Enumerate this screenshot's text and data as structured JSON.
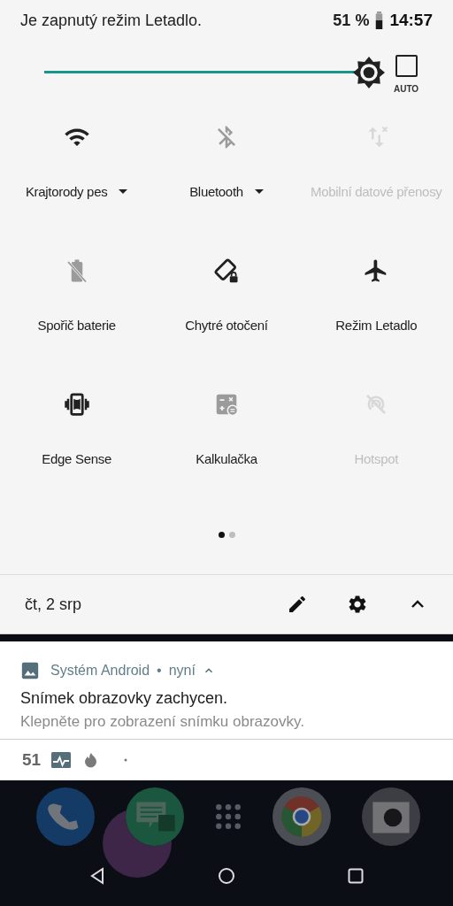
{
  "status_bar": {
    "message": "Je zapnutý režim Letadlo.",
    "battery": "51 %",
    "time": "14:57"
  },
  "brightness": {
    "level": 0.96,
    "auto": false,
    "auto_label": "AUTO"
  },
  "tiles": [
    {
      "kind": "wifi",
      "label": "Krajtorody pes",
      "on": true,
      "disabled": false,
      "has_menu": true
    },
    {
      "kind": "bluetooth",
      "label": "Bluetooth",
      "on": false,
      "disabled": false,
      "has_menu": true
    },
    {
      "kind": "data",
      "label": "Mobilní datové přenosy",
      "on": false,
      "disabled": true,
      "has_menu": false
    },
    {
      "kind": "battery",
      "label": "Spořič baterie",
      "on": false,
      "disabled": false,
      "has_menu": false
    },
    {
      "kind": "rotate",
      "label": "Chytré otočení",
      "on": true,
      "disabled": false,
      "has_menu": false
    },
    {
      "kind": "airplane",
      "label": "Režim Letadlo",
      "on": true,
      "disabled": false,
      "has_menu": false
    },
    {
      "kind": "edge",
      "label": "Edge Sense",
      "on": true,
      "disabled": false,
      "has_menu": false
    },
    {
      "kind": "calculator",
      "label": "Kalkulačka",
      "on": false,
      "disabled": false,
      "has_menu": false
    },
    {
      "kind": "hotspot",
      "label": "Hotspot",
      "on": false,
      "disabled": true,
      "has_menu": false
    }
  ],
  "pages": [
    {
      "selected": true
    },
    {
      "selected": false
    }
  ],
  "footer": {
    "date": "čt, 2 srp"
  },
  "notification": {
    "app": "Systém Android",
    "separator": "•",
    "time": "nyní",
    "title": "Snímek obrazovky zachycen.",
    "text": "Klepněte pro zobrazení snímku obrazovky."
  },
  "notification_strip": {
    "count": "51"
  }
}
